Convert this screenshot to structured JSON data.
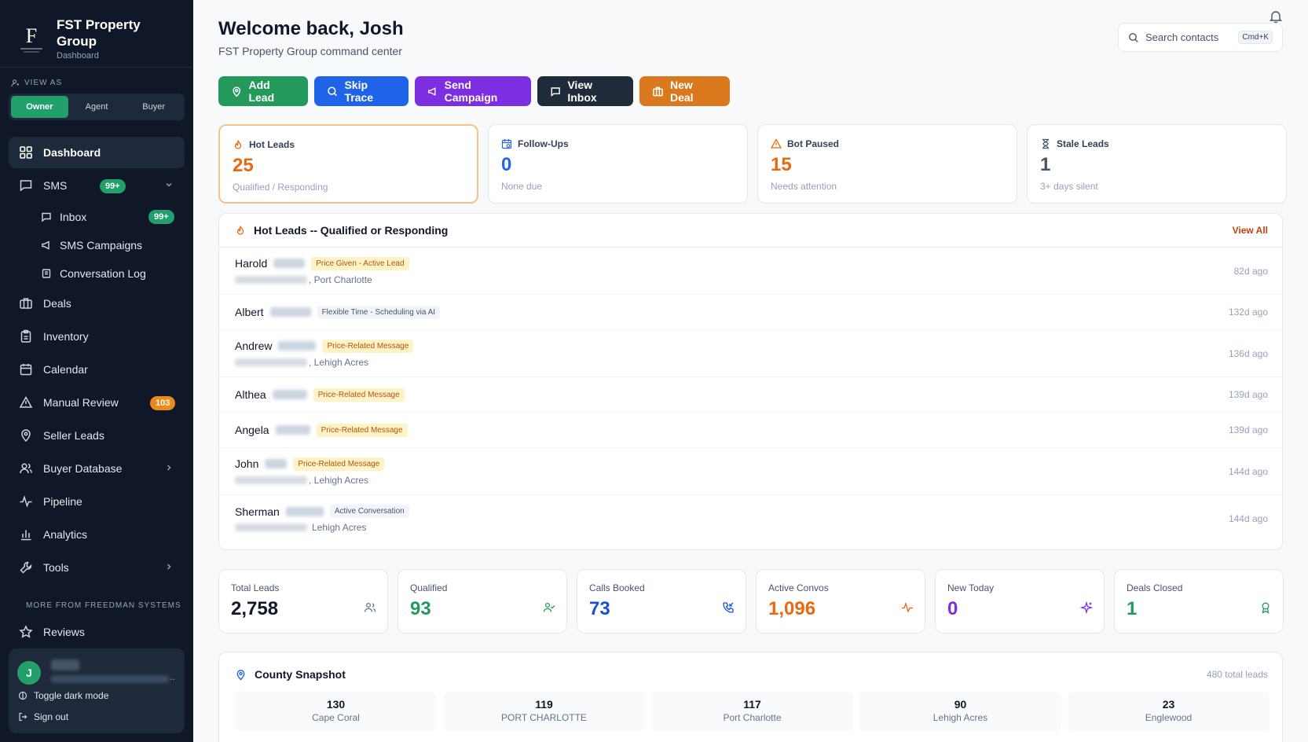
{
  "brand": {
    "name": "FST Property Group",
    "section": "Dashboard"
  },
  "view_as": {
    "label": "VIEW AS",
    "options": [
      "Owner",
      "Agent",
      "Buyer"
    ],
    "selected": "Owner"
  },
  "nav": {
    "dashboard": "Dashboard",
    "sms": {
      "label": "SMS",
      "badge": "99+"
    },
    "inbox": {
      "label": "Inbox",
      "badge": "99+"
    },
    "sms_campaigns": "SMS Campaigns",
    "conversation_log": "Conversation Log",
    "deals": "Deals",
    "inventory": "Inventory",
    "calendar": "Calendar",
    "manual_review": {
      "label": "Manual Review",
      "badge": "103"
    },
    "seller_leads": "Seller Leads",
    "buyer_database": "Buyer Database",
    "pipeline": "Pipeline",
    "analytics": "Analytics",
    "tools": "Tools",
    "more_label": "MORE FROM FREEDMAN SYSTEMS",
    "reviews": "Reviews"
  },
  "user": {
    "initial": "J",
    "toggle_dark": "Toggle dark mode",
    "sign_out": "Sign out"
  },
  "header": {
    "title": "Welcome back, Josh",
    "subtitle": "FST Property Group command center"
  },
  "search": {
    "placeholder": "Search contacts",
    "shortcut": "Cmd+K"
  },
  "actions": [
    {
      "label": "Add Lead",
      "color": "#239a5c"
    },
    {
      "label": "Skip Trace",
      "color": "#1f63e8"
    },
    {
      "label": "Send Campaign",
      "color": "#7c2ee0"
    },
    {
      "label": "View Inbox",
      "color": "#1f2a3a"
    },
    {
      "label": "New Deal",
      "color": "#d9781d"
    }
  ],
  "stats": [
    {
      "label": "Hot Leads",
      "value": "25",
      "sub": "Qualified / Responding",
      "color": "#e8690e"
    },
    {
      "label": "Follow-Ups",
      "value": "0",
      "sub": "None due",
      "color": "#2563eb"
    },
    {
      "label": "Bot Paused",
      "value": "15",
      "sub": "Needs attention",
      "color": "#e8690e"
    },
    {
      "label": "Stale Leads",
      "value": "1",
      "sub": "3+ days silent",
      "color": "#475569"
    }
  ],
  "hot_leads": {
    "title": "Hot Leads -- Qualified or Responding",
    "view_all": "View All",
    "rows": [
      {
        "first": "Harold",
        "tag": "Price Given - Active Lead",
        "tag_style": "orange",
        "location": ", Port Charlotte",
        "time": "82d ago"
      },
      {
        "first": "Albert",
        "tag": "Flexible Time - Scheduling via AI",
        "tag_style": "gray",
        "location": "",
        "time": "132d ago"
      },
      {
        "first": "Andrew",
        "tag": "Price-Related Message",
        "tag_style": "orange",
        "location": ", Lehigh Acres",
        "time": "136d ago"
      },
      {
        "first": "Althea",
        "tag": "Price-Related Message",
        "tag_style": "orange",
        "location": "",
        "time": "139d ago"
      },
      {
        "first": "Angela",
        "tag": "Price-Related Message",
        "tag_style": "orange",
        "location": "",
        "time": "139d ago"
      },
      {
        "first": "John",
        "tag": "Price-Related Message",
        "tag_style": "orange",
        "location": ", Lehigh Acres",
        "time": "144d ago"
      },
      {
        "first": "Sherman",
        "tag": "Active Conversation",
        "tag_style": "gray",
        "location": "Lehigh Acres",
        "time": "144d ago"
      }
    ]
  },
  "metrics": [
    {
      "label": "Total Leads",
      "value": "2,758",
      "color": "#111827",
      "icon": "users-icon"
    },
    {
      "label": "Qualified",
      "value": "93",
      "color": "#239a5c",
      "icon": "user-check-icon"
    },
    {
      "label": "Calls Booked",
      "value": "73",
      "color": "#1d4ed8",
      "icon": "phone-incoming-icon"
    },
    {
      "label": "Active Convos",
      "value": "1,096",
      "color": "#e8690e",
      "icon": "activity-icon"
    },
    {
      "label": "New Today",
      "value": "0",
      "color": "#7c2ee0",
      "icon": "sparkles-icon"
    },
    {
      "label": "Deals Closed",
      "value": "1",
      "color": "#239a5c",
      "icon": "award-icon"
    }
  ],
  "county": {
    "title": "County Snapshot",
    "total": "480 total leads",
    "cells": [
      {
        "count": "130",
        "name": "Cape Coral"
      },
      {
        "count": "119",
        "name": "PORT CHARLOTTE"
      },
      {
        "count": "117",
        "name": "Port Charlotte"
      },
      {
        "count": "90",
        "name": "Lehigh Acres"
      },
      {
        "count": "23",
        "name": "Englewood"
      }
    ]
  }
}
